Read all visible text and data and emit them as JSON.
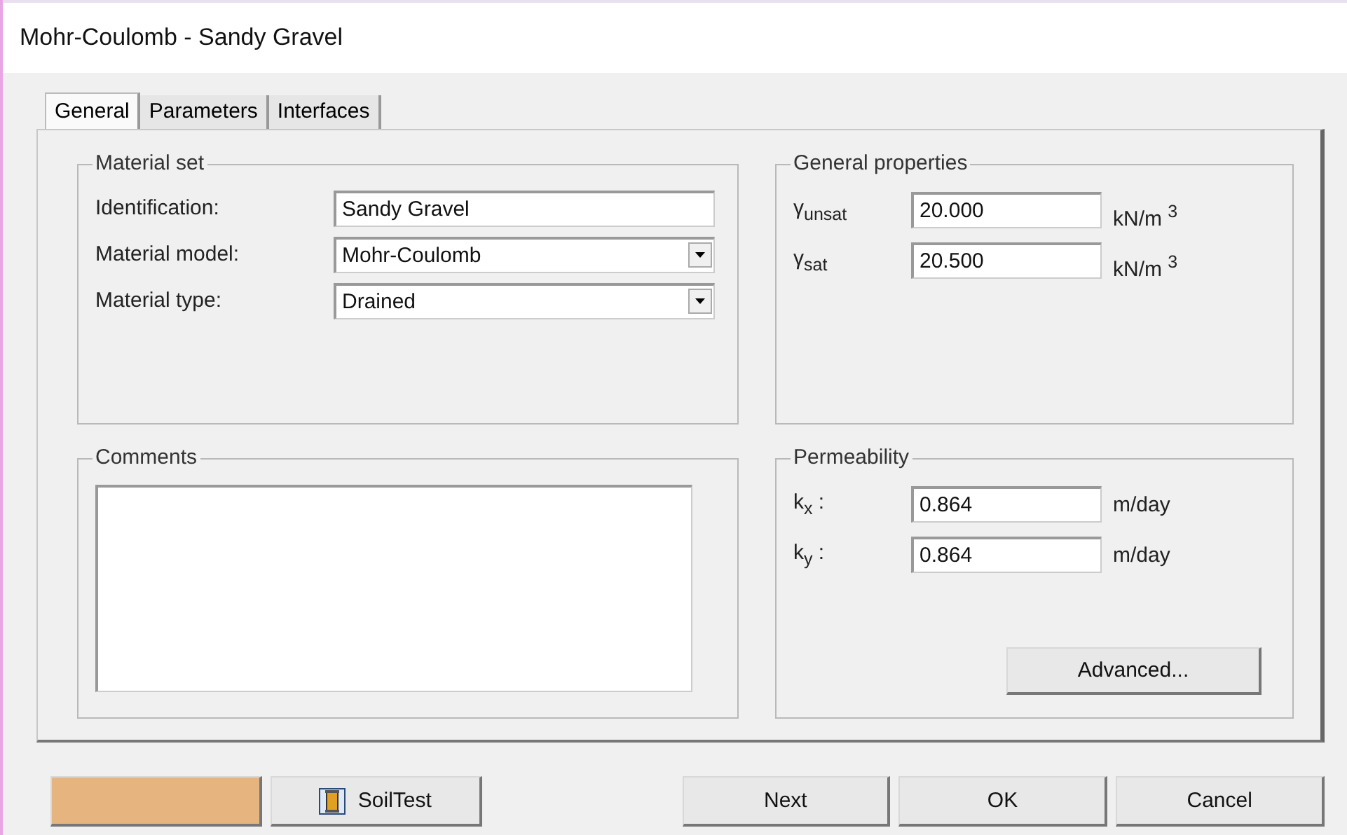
{
  "window": {
    "title": "Mohr-Coulomb - Sandy Gravel"
  },
  "tabs": [
    {
      "label": "General",
      "selected": true
    },
    {
      "label": "Parameters",
      "selected": false
    },
    {
      "label": "Interfaces",
      "selected": false
    }
  ],
  "material_set": {
    "title": "Material set",
    "rows": [
      {
        "kind": "text",
        "label": "Identification:",
        "value": "Sandy Gravel"
      },
      {
        "kind": "dropdown",
        "label": "Material model:",
        "value": "Mohr-Coulomb"
      },
      {
        "kind": "dropdown",
        "label": "Material type:",
        "value": "Drained"
      }
    ]
  },
  "general_properties": {
    "title": "General properties",
    "rows": [
      {
        "symbol": "γ$_{unsat}$",
        "value": "20.000",
        "unit": "kN/m $^{3}$"
      },
      {
        "symbol": "γ$_{sat}$",
        "value": "20.500",
        "unit": "kN/m $^{3}$"
      }
    ]
  },
  "comments": {
    "title": "Comments"
  },
  "permeability": {
    "title": "Permeability",
    "rows": [
      {
        "symbol": "k$_{x}$ :",
        "value": "0.864",
        "unit": "m/day"
      },
      {
        "symbol": "k$_{y}$ :",
        "value": "0.864",
        "unit": "m/day"
      }
    ],
    "button": "Advanced..."
  },
  "footer": {
    "color": "#e6b47f",
    "soiltest": "SoilTest",
    "buttons": [
      "Next",
      "OK",
      "Cancel"
    ]
  }
}
